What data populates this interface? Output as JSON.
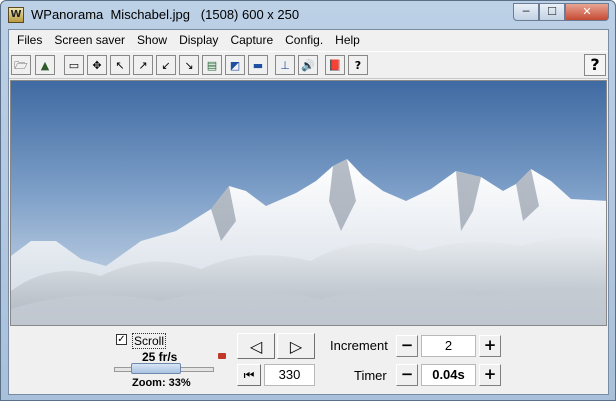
{
  "window": {
    "app_name": "WPanorama",
    "title": "WPanorama  Mischabel.jpg   (1508) 600 x 250",
    "controls": {
      "minimize": "─",
      "maximize": "☐",
      "close": "✕"
    }
  },
  "menu": [
    "Files",
    "Screen saver",
    "Show",
    "Display",
    "Capture",
    "Config.",
    "Help"
  ],
  "toolbar": {
    "buttons": [
      {
        "name": "open-file-icon",
        "glyph": "🗁"
      },
      {
        "name": "picture-icon",
        "glyph": "▲"
      },
      {
        "name": "fit-window-icon",
        "glyph": "▭"
      },
      {
        "name": "move-icon",
        "glyph": "✥"
      },
      {
        "name": "arrow-up-left-icon",
        "glyph": "↖"
      },
      {
        "name": "arrow-up-right-icon",
        "glyph": "↗"
      },
      {
        "name": "arrow-down-left-icon",
        "glyph": "↙"
      },
      {
        "name": "arrow-down-right-icon",
        "glyph": "↘"
      },
      {
        "name": "panorama-icon",
        "glyph": "▤"
      },
      {
        "name": "image-blue-icon",
        "glyph": "◩"
      },
      {
        "name": "strip-icon",
        "glyph": "▬"
      },
      {
        "name": "tripod-icon",
        "glyph": "⊥"
      },
      {
        "name": "speaker-icon",
        "glyph": "🔊"
      },
      {
        "name": "book-icon",
        "glyph": "📕"
      },
      {
        "name": "help-book-icon",
        "glyph": "?"
      }
    ],
    "help_glyph": "?"
  },
  "controls": {
    "scroll_label": "Scroll",
    "scroll_checked": true,
    "check_glyph": "✓",
    "fps": "25 fr/s",
    "zoom": "Zoom: 33%",
    "zoom_fraction": 0.33,
    "prev_glyph": "◁",
    "next_glyph": "▷",
    "first_glyph": "⏮",
    "position": "330",
    "increment_label": "Increment",
    "increment_value": "2",
    "timer_label": "Timer",
    "timer_value": "0.04s",
    "minus": "−",
    "plus": "+"
  },
  "colors": {
    "accent": "#a9c3e0",
    "close": "#c54a33",
    "sky": "#4f79ad"
  }
}
